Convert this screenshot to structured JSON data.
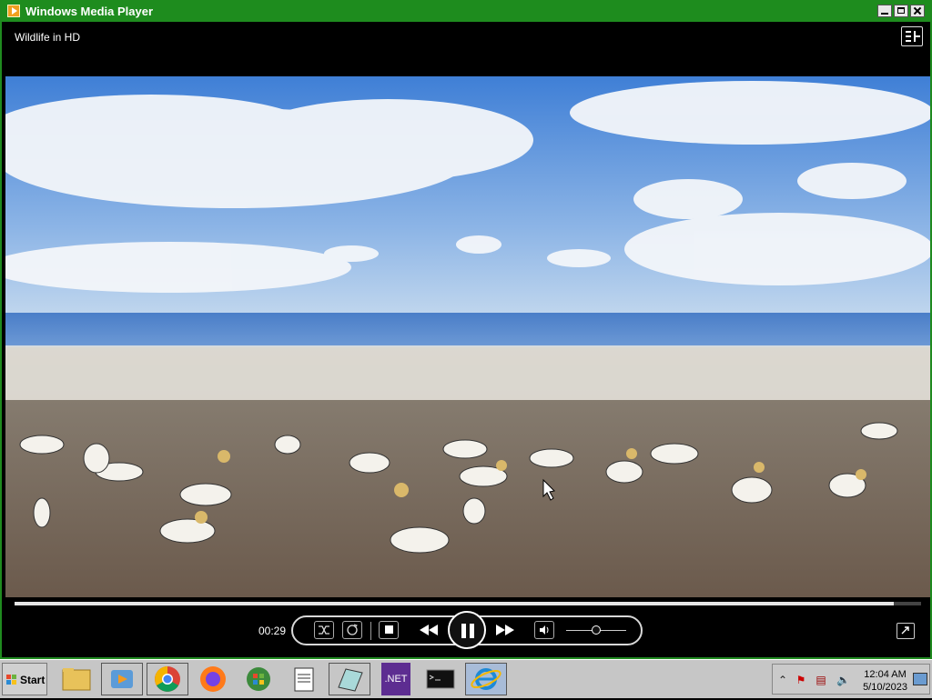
{
  "window": {
    "title": "Windows Media Player",
    "media_title": "Wildlife in HD"
  },
  "playback": {
    "elapsed": "00:29",
    "progress_fraction": 0.97,
    "volume_fraction": 0.5,
    "state": "playing"
  },
  "icons": {
    "shuffle": "shuffle-icon",
    "repeat": "repeat-icon",
    "stop": "stop-icon",
    "previous": "previous-icon",
    "pause": "pause-icon",
    "next": "next-icon",
    "mute": "speaker-icon",
    "switch_view": "switch-to-library-icon",
    "fullscreen": "fullscreen-icon"
  },
  "taskbar": {
    "start_label": "Start",
    "items": [
      {
        "name": "file-explorer",
        "label": ""
      },
      {
        "name": "media-center",
        "label": ""
      },
      {
        "name": "chrome",
        "label": ""
      },
      {
        "name": "firefox",
        "label": ""
      },
      {
        "name": "windows-update",
        "label": ""
      },
      {
        "name": "notepad",
        "label": ""
      },
      {
        "name": "paint",
        "label": ""
      },
      {
        "name": "dotnet",
        "label": ".NET"
      },
      {
        "name": "command-prompt",
        "label": ""
      },
      {
        "name": "internet-explorer",
        "label": ""
      }
    ],
    "clock_time": "12:04 AM",
    "clock_date": "5/10/2023"
  },
  "colors": {
    "titlebar": "#1e8c1e",
    "accent_dotnet": "#5d2d91"
  }
}
